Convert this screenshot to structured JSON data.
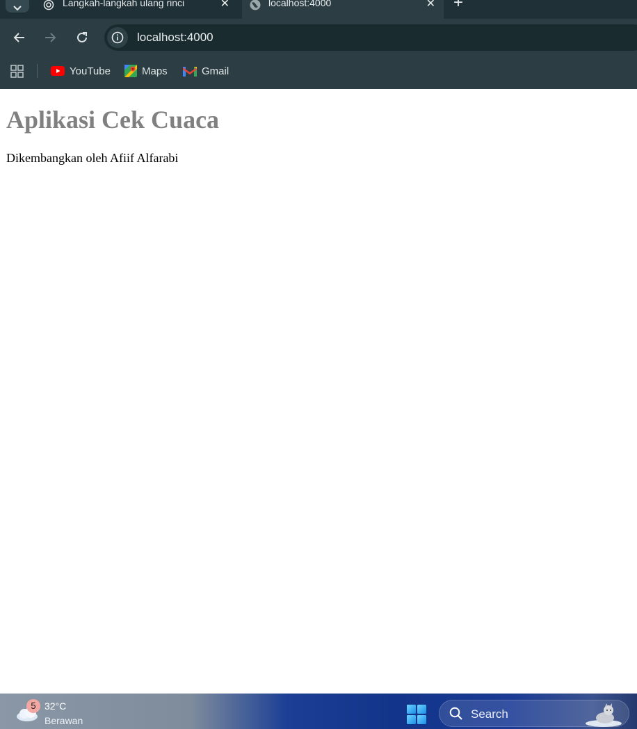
{
  "browser": {
    "tabs": [
      {
        "title": "Langkah-langkah ulang rinci",
        "favicon": "openai-icon",
        "active": false
      },
      {
        "title": "localhost:4000",
        "favicon": "globe-icon",
        "active": true
      }
    ],
    "address_bar": {
      "url": "localhost:4000"
    },
    "bookmarks": [
      {
        "label": "YouTube",
        "icon": "youtube-icon"
      },
      {
        "label": "Maps",
        "icon": "maps-icon"
      },
      {
        "label": "Gmail",
        "icon": "gmail-icon"
      }
    ]
  },
  "page": {
    "title": "Aplikasi Cek Cuaca",
    "subtitle": "Dikembangkan oleh Afiif Alfarabi"
  },
  "taskbar": {
    "weather": {
      "badge": "5",
      "temperature": "32°C",
      "description": "Berawan"
    },
    "search_placeholder": "Search"
  },
  "colors": {
    "chrome_bg": "#2c3e44",
    "tabstrip_bg": "#1f3036",
    "page_title": "#808080"
  }
}
